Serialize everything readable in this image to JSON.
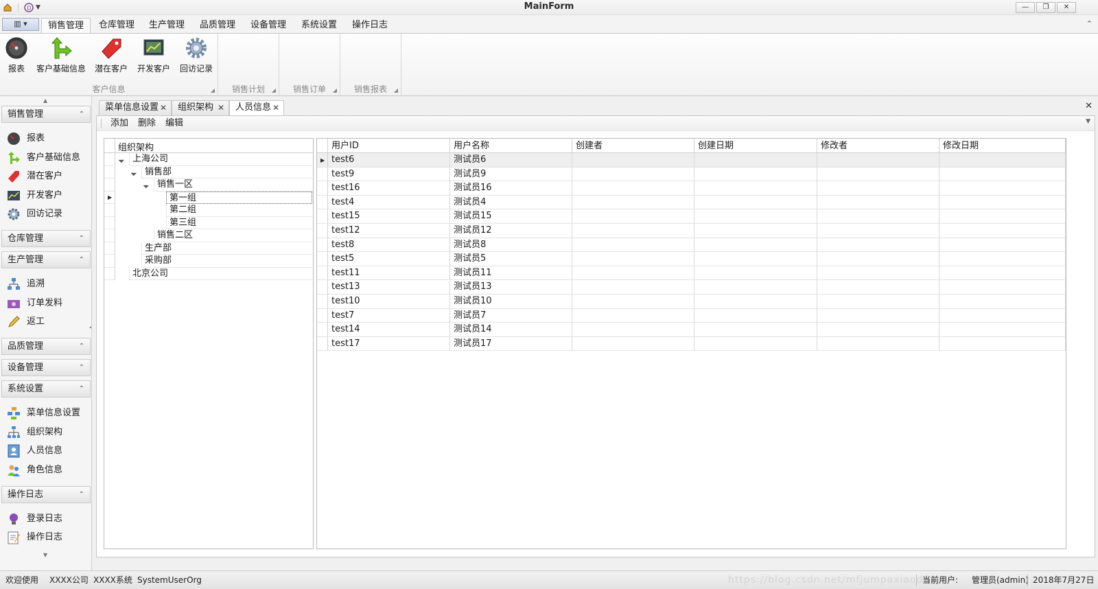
{
  "window": {
    "title": "MainForm"
  },
  "ribbon": {
    "tabs": [
      "销售管理",
      "仓库管理",
      "生产管理",
      "品质管理",
      "设备管理",
      "系统设置",
      "操作日志"
    ],
    "active_tab": "销售管理",
    "buttons": [
      {
        "label": "报表",
        "icon": "gauge-icon"
      },
      {
        "label": "客户基础信息",
        "icon": "green-arrow-icon"
      },
      {
        "label": "潜在客户",
        "icon": "tag-icon"
      },
      {
        "label": "开发客户",
        "icon": "chart-screen-icon"
      },
      {
        "label": "回访记录",
        "icon": "gear-icon"
      }
    ],
    "groups": [
      "客户信息",
      "销售计划",
      "销售订单",
      "销售报表"
    ]
  },
  "nav": {
    "sections": [
      {
        "title": "销售管理",
        "items": [
          "报表",
          "客户基础信息",
          "潜在客户",
          "开发客户",
          "回访记录"
        ]
      },
      {
        "title": "仓库管理",
        "items": []
      },
      {
        "title": "生产管理",
        "items": [
          "追溯",
          "订单发料",
          "返工"
        ]
      },
      {
        "title": "品质管理",
        "items": []
      },
      {
        "title": "设备管理",
        "items": []
      },
      {
        "title": "系统设置",
        "items": [
          "菜单信息设置",
          "组织架构",
          "人员信息",
          "角色信息"
        ]
      },
      {
        "title": "操作日志",
        "items": [
          "登录日志",
          "操作日志"
        ]
      }
    ]
  },
  "doc_tabs": [
    "菜单信息设置",
    "组织架构",
    "人员信息"
  ],
  "active_doc_tab": "人员信息",
  "toolbar": {
    "add": "添加",
    "delete": "删除",
    "edit": "编辑"
  },
  "tree": {
    "header": "组织架构",
    "nodes": [
      {
        "label": "上海公司",
        "level": 0,
        "expanded": true
      },
      {
        "label": "销售部",
        "level": 1,
        "expanded": true
      },
      {
        "label": "销售一区",
        "level": 2,
        "expanded": true
      },
      {
        "label": "第一组",
        "level": 3,
        "selected": true
      },
      {
        "label": "第二组",
        "level": 3
      },
      {
        "label": "第三组",
        "level": 3
      },
      {
        "label": "销售二区",
        "level": 2
      },
      {
        "label": "生产部",
        "level": 1
      },
      {
        "label": "采购部",
        "level": 1
      },
      {
        "label": "北京公司",
        "level": 0
      }
    ]
  },
  "grid": {
    "columns": [
      "用户ID",
      "用户名称",
      "创建者",
      "创建日期",
      "修改者",
      "修改日期"
    ],
    "rows": [
      [
        "test6",
        "测试员6"
      ],
      [
        "test9",
        "测试员9"
      ],
      [
        "test16",
        "测试员16"
      ],
      [
        "test4",
        "测试员4"
      ],
      [
        "test15",
        "测试员15"
      ],
      [
        "test12",
        "测试员12"
      ],
      [
        "test8",
        "测试员8"
      ],
      [
        "test5",
        "测试员5"
      ],
      [
        "test11",
        "测试员11"
      ],
      [
        "test13",
        "测试员13"
      ],
      [
        "test10",
        "测试员10"
      ],
      [
        "test7",
        "测试员7"
      ],
      [
        "test14",
        "测试员14"
      ],
      [
        "test17",
        "测试员17"
      ]
    ]
  },
  "status": {
    "welcome": "欢迎使用",
    "company": "XXXX公司",
    "system": "XXXX系统",
    "form": "SystemUserOrg",
    "current_user_label": "当前用户:",
    "current_user": "管理员(admin)",
    "date": "2018年7月27日",
    "watermark": "https://blog.csdn.net/mfjumpaxiaode"
  }
}
